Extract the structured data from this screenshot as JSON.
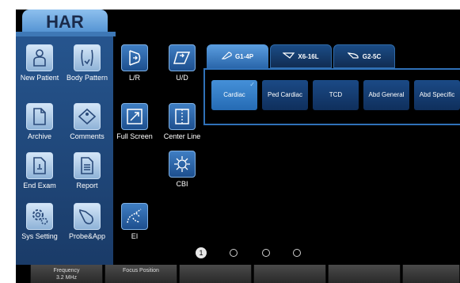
{
  "app": {
    "title": "HAR"
  },
  "left_tiles": [
    {
      "label": "New Patient",
      "icon": "person-icon"
    },
    {
      "label": "Body Pattern",
      "icon": "body-icon"
    },
    {
      "label": "Archive",
      "icon": "document-icon"
    },
    {
      "label": "Comments",
      "icon": "tag-icon"
    },
    {
      "label": "End Exam",
      "icon": "end-exam-icon"
    },
    {
      "label": "Report",
      "icon": "report-icon"
    },
    {
      "label": "Sys Setting",
      "icon": "gear-icon"
    },
    {
      "label": "Probe&App",
      "icon": "probe-icon"
    }
  ],
  "mid_tiles": [
    {
      "label": "L/R",
      "icon": "flip-lr-icon"
    },
    {
      "label": "U/D",
      "icon": "flip-ud-icon"
    },
    {
      "label": "Full Screen",
      "icon": "fullscreen-icon"
    },
    {
      "label": "Center Line",
      "icon": "center-line-icon"
    },
    {
      "label": "CBI",
      "icon": "cbi-icon"
    },
    {
      "label": "EI",
      "icon": "ei-icon"
    }
  ],
  "probe_tabs": [
    {
      "label": "G1-4P",
      "active": true
    },
    {
      "label": "X6-16L",
      "active": false
    },
    {
      "label": "G2-5C",
      "active": false
    }
  ],
  "presets": [
    {
      "label": "Cardiac",
      "selected": true
    },
    {
      "label": "Ped Cardiac",
      "selected": false
    },
    {
      "label": "TCD",
      "selected": false
    },
    {
      "label": "Abd General",
      "selected": false
    },
    {
      "label": "Abd Specific",
      "selected": false
    }
  ],
  "pager": {
    "current": "1",
    "total": 4
  },
  "bottom_controls": [
    {
      "label": "Frequency",
      "value": "3.2 MHz"
    },
    {
      "label": "Focus Position",
      "value": ""
    },
    {
      "label": "",
      "value": ""
    },
    {
      "label": "",
      "value": ""
    },
    {
      "label": "",
      "value": ""
    },
    {
      "label": "",
      "value": ""
    }
  ],
  "colors": {
    "accent": "#2f71b8",
    "panel": "#1f4a7e",
    "selected": "#3d86d0"
  }
}
